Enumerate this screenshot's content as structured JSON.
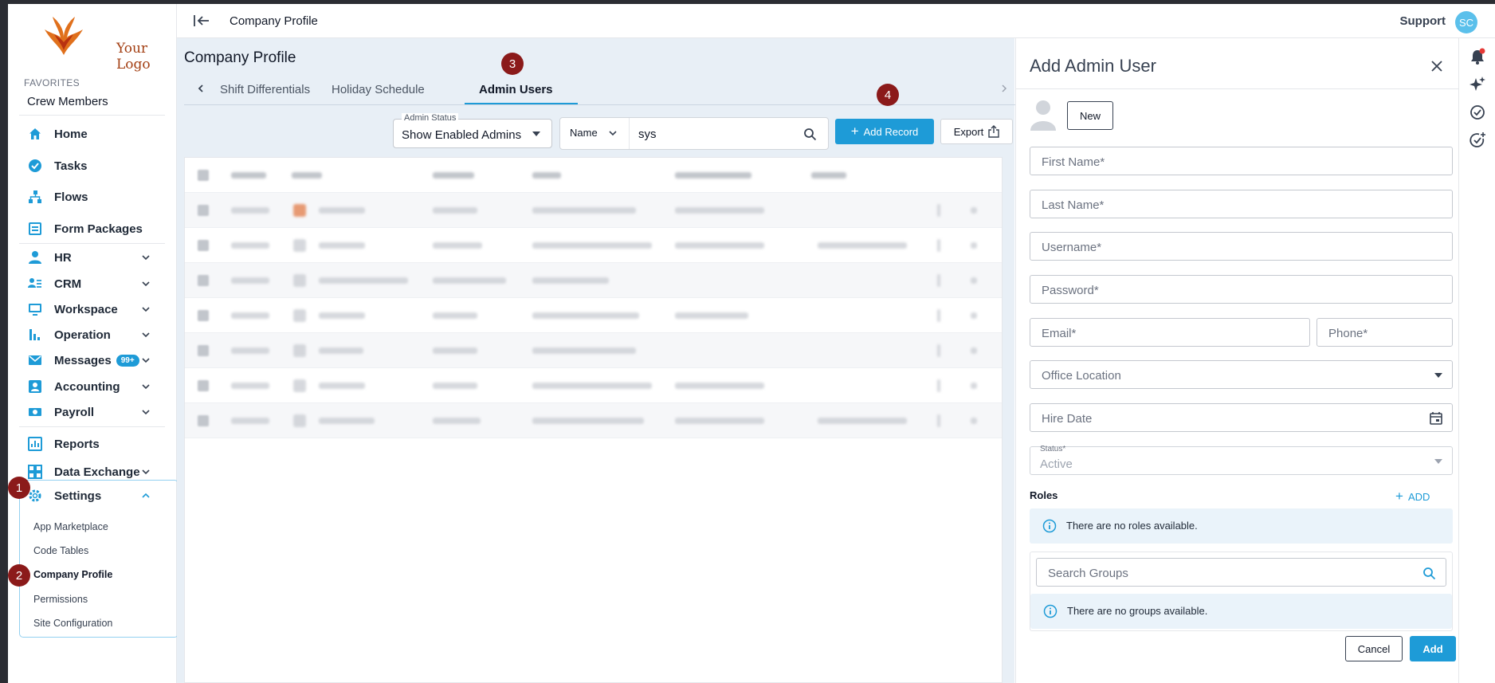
{
  "sidebar": {
    "logo_text": "Your Logo",
    "favorites_title": "FAVORITES",
    "favorites": [
      "Crew Members"
    ],
    "nav": [
      {
        "label": "Home",
        "icon": "home-icon"
      },
      {
        "label": "Tasks",
        "icon": "tasks-check-icon"
      },
      {
        "label": "Flows",
        "icon": "flows-icon"
      },
      {
        "label": "Form Packages",
        "icon": "form-packages-icon"
      },
      {
        "label": "HR",
        "icon": "person-icon"
      },
      {
        "label": "CRM",
        "icon": "crm-icon"
      },
      {
        "label": "Workspace",
        "icon": "workspace-monitor-icon"
      },
      {
        "label": "Operation",
        "icon": "bar-chart-icon"
      },
      {
        "label": "Messages",
        "icon": "messages-icon",
        "badge": "99+"
      },
      {
        "label": "Accounting",
        "icon": "accounting-icon"
      },
      {
        "label": "Payroll",
        "icon": "payroll-icon"
      },
      {
        "label": "Reports",
        "icon": "reports-icon"
      },
      {
        "label": "Data Exchange",
        "icon": "data-exchange-icon"
      },
      {
        "label": "Settings",
        "icon": "gear-icon"
      }
    ],
    "settings_children": [
      "App Marketplace",
      "Code Tables",
      "Company Profile",
      "Permissions",
      "Site Configuration"
    ]
  },
  "markers": [
    "1",
    "2",
    "3",
    "4"
  ],
  "topbar": {
    "breadcrumb": "Company Profile",
    "support": "Support",
    "avatar_initials": "SC"
  },
  "main": {
    "title": "Company Profile",
    "tabs": [
      "Shift Differentials",
      "Holiday Schedule",
      "Admin Users"
    ],
    "active_tab": "Admin Users",
    "admin_status": {
      "label": "Admin Status",
      "value": "Show Enabled Admins"
    },
    "search": {
      "field": "Name",
      "query": "sys"
    },
    "add_record": "Add Record",
    "export": "Export"
  },
  "drawer": {
    "title": "Add Admin User",
    "new_button": "New",
    "fields": {
      "first_name": "First Name*",
      "last_name": "Last Name*",
      "username": "Username*",
      "password": "Password*",
      "email": "Email*",
      "phone": "Phone*",
      "office_location": "Office Location",
      "hire_date": "Hire Date",
      "status_label": "Status*",
      "status_value": "Active"
    },
    "roles_title": "Roles",
    "roles_add": "ADD",
    "no_roles": "There are no roles available.",
    "search_groups": "Search Groups",
    "no_groups": "There are no groups available.",
    "cancel": "Cancel",
    "add": "Add"
  },
  "colors": {
    "accent": "#1e9bd7",
    "marker": "#8b1a1a",
    "main_bg": "#e8eff6"
  }
}
